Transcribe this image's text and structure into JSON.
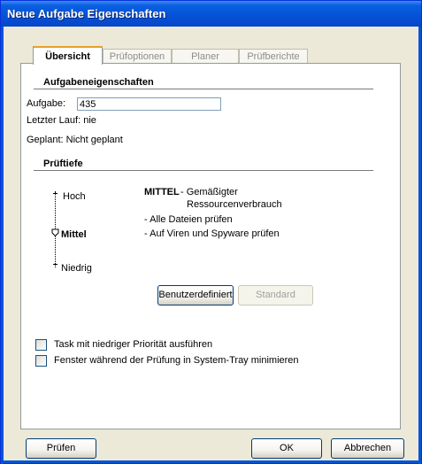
{
  "window": {
    "title": "Neue Aufgabe Eigenschaften"
  },
  "tabs": [
    {
      "label": "Übersicht",
      "active": true
    },
    {
      "label": "Prüfoptionen",
      "active": false
    },
    {
      "label": "Planer",
      "active": false
    },
    {
      "label": "Prüfberichte",
      "active": false
    }
  ],
  "properties": {
    "heading": "Aufgabeneigenschaften",
    "task_label": "Aufgabe:",
    "task_value": "435",
    "last_run": "Letzter Lauf: nie",
    "scheduled": "Geplant: Nicht geplant"
  },
  "depth": {
    "heading": "Prüftiefe",
    "levels": [
      "Hoch",
      "Mittel",
      "Niedrig"
    ],
    "selected": "Mittel",
    "title": "MITTEL",
    "description_line1": "- Gemäßigter",
    "description_line2": "Ressourcenverbrauch",
    "bullet1": "- Alle Dateien prüfen",
    "bullet2": "- Auf Viren und Spyware prüfen",
    "custom_button": "Benutzerdefiniert",
    "standard_button": "Standard"
  },
  "options": {
    "low_priority": {
      "label": "Task mit niedriger Priorität ausführen",
      "checked": false
    },
    "minimize_tray": {
      "label": "Fenster während der Prüfung in System-Tray minimieren",
      "checked": false
    }
  },
  "footer": {
    "scan_button": "Prüfen",
    "ok_button": "OK",
    "cancel_button": "Abbrechen"
  }
}
